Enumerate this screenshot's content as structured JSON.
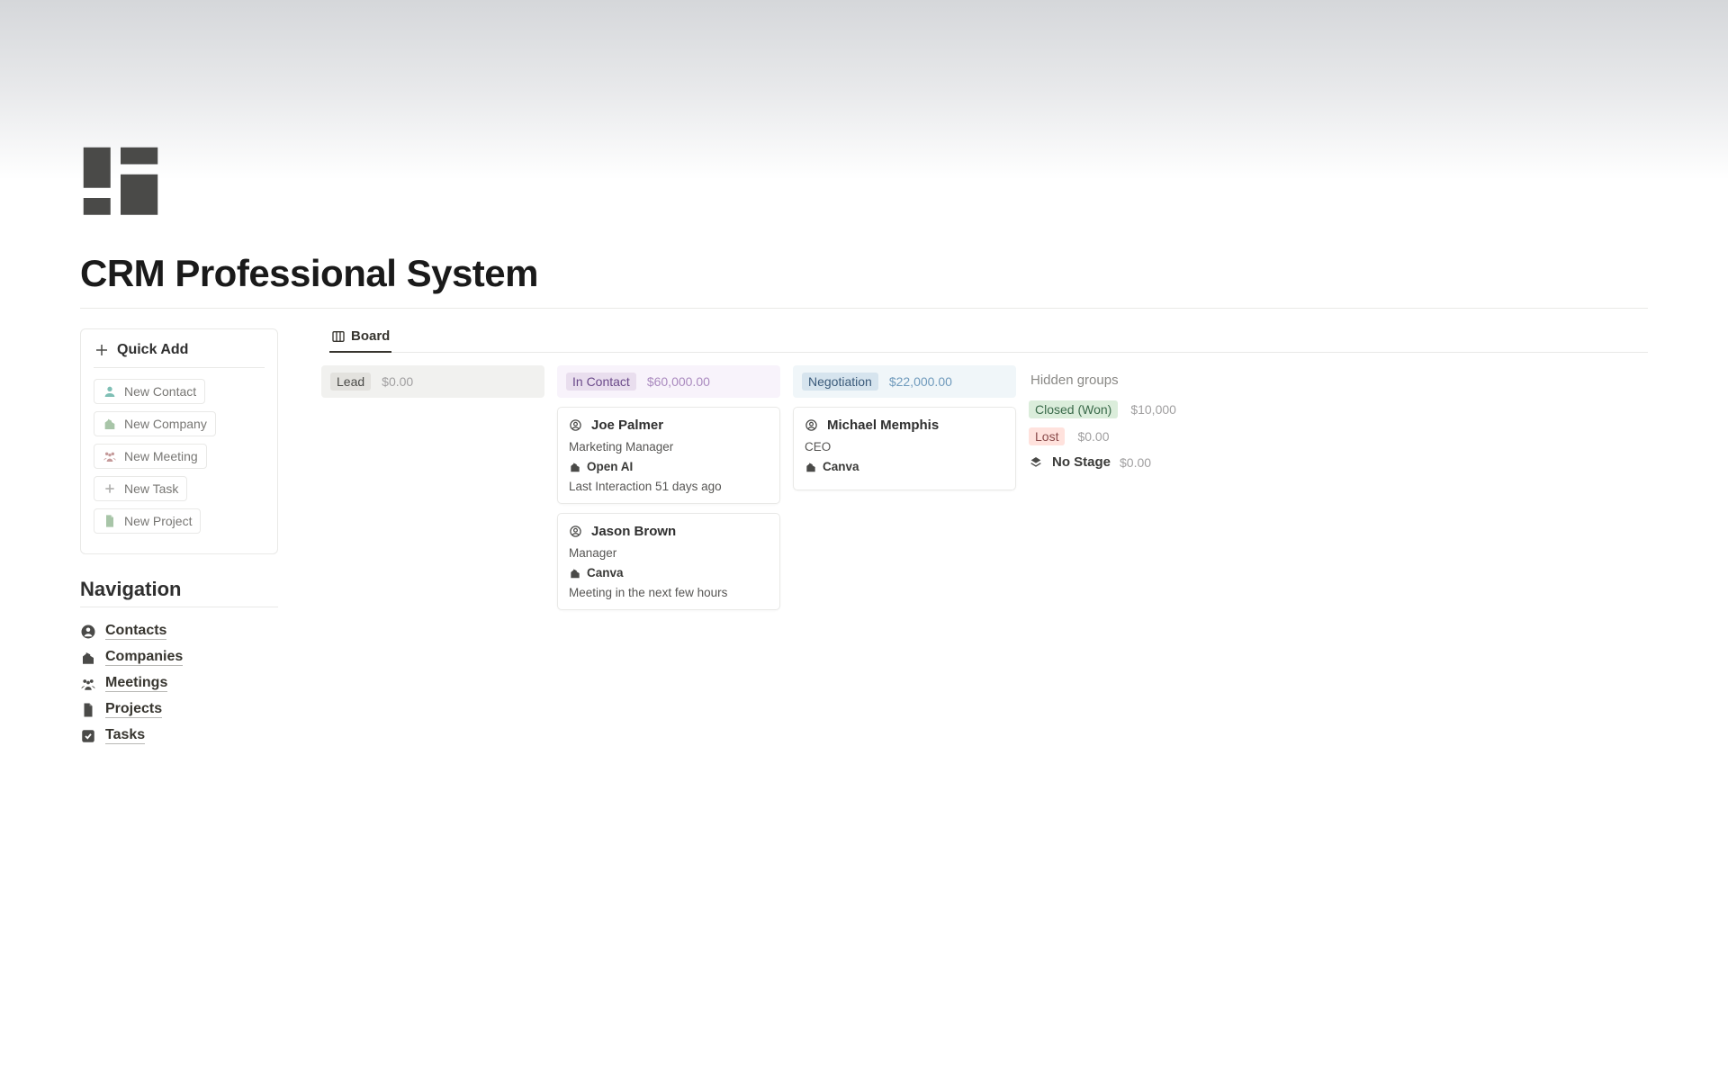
{
  "page": {
    "title": "CRM Professional System"
  },
  "quickAdd": {
    "heading": "Quick Add",
    "buttons": [
      {
        "label": "New Contact",
        "icon": "person",
        "iconColor": "#7fbfb5"
      },
      {
        "label": "New Company",
        "icon": "building",
        "iconColor": "#a8c5a8"
      },
      {
        "label": "New Meeting",
        "icon": "people",
        "iconColor": "#c59a9a"
      },
      {
        "label": "New Task",
        "icon": "plus",
        "iconColor": "#b0b0ae"
      },
      {
        "label": "New Project",
        "icon": "file",
        "iconColor": "#a8c5a8"
      }
    ]
  },
  "navigation": {
    "heading": "Navigation",
    "items": [
      {
        "label": "Contacts",
        "icon": "account"
      },
      {
        "label": "Companies",
        "icon": "building"
      },
      {
        "label": "Meetings",
        "icon": "people"
      },
      {
        "label": "Projects",
        "icon": "file"
      },
      {
        "label": "Tasks",
        "icon": "check"
      }
    ]
  },
  "board": {
    "tab": "Board",
    "columns": [
      {
        "stage": "Lead",
        "tagClass": "lead",
        "bgClass": "bg-lead",
        "amount": "$0.00",
        "amountClass": "",
        "cards": []
      },
      {
        "stage": "In Contact",
        "tagClass": "incontact",
        "bgClass": "bg-incontact",
        "amount": "$60,000.00",
        "amountClass": "purple",
        "cards": [
          {
            "name": "Joe Palmer",
            "role": "Marketing Manager",
            "company": "Open AI",
            "meta": "Last Interaction 51 days ago"
          },
          {
            "name": "Jason Brown",
            "role": "Manager",
            "company": "Canva",
            "meta": "Meeting in the next few hours"
          }
        ]
      },
      {
        "stage": "Negotiation",
        "tagClass": "negotiation",
        "bgClass": "bg-negotiation",
        "amount": "$22,000.00",
        "amountClass": "blue",
        "cards": [
          {
            "name": "Michael Memphis",
            "role": "CEO",
            "company": "Canva",
            "meta": ""
          }
        ]
      }
    ],
    "hidden": {
      "title": "Hidden groups",
      "rows": [
        {
          "label": "Closed (Won)",
          "tagClass": "closedwon",
          "amount": "$10,000"
        },
        {
          "label": "Lost",
          "tagClass": "lost",
          "amount": "$0.00"
        }
      ],
      "noStage": {
        "label": "No Stage",
        "amount": "$0.00"
      }
    }
  }
}
